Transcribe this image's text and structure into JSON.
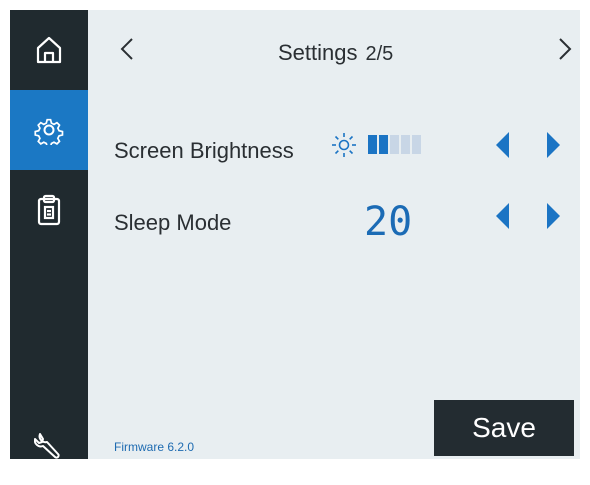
{
  "sidebar": {
    "items": [
      {
        "icon": "home-icon",
        "active": false
      },
      {
        "icon": "gear-icon",
        "active": true
      },
      {
        "icon": "clipboard-icon",
        "active": false
      },
      {
        "icon": "wrench-icon",
        "active": false
      }
    ]
  },
  "header": {
    "title": "Settings",
    "page": "2/5"
  },
  "settings": {
    "brightness": {
      "label": "Screen Brightness",
      "level": 2,
      "max": 5,
      "icon": "sun-icon"
    },
    "sleep": {
      "label": "Sleep Mode",
      "value": "20"
    }
  },
  "footer": {
    "firmware": "Firmware 6.2.0",
    "save_label": "Save"
  },
  "colors": {
    "accent": "#1b78c4",
    "sidebar_bg": "#202a2f",
    "panel_bg": "#e8eef1"
  }
}
